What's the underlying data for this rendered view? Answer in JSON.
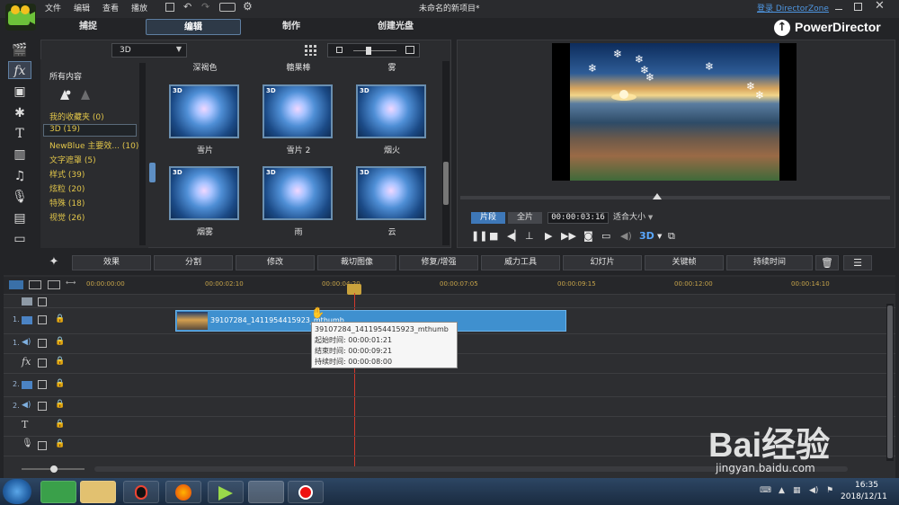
{
  "menu": {
    "file": "文件",
    "edit": "编辑",
    "view": "查看",
    "play": "播放",
    "project_title": "未命名的新项目*",
    "login": "登录 DirectorZone"
  },
  "brand": {
    "name": "PowerDirector"
  },
  "tabs": {
    "capture": "捕捉",
    "edit": "编辑",
    "produce": "制作",
    "disc": "创建光盘"
  },
  "library": {
    "filter_value": "3D",
    "all_content": "所有内容",
    "top_labels": [
      "深褐色",
      "糖果棒",
      "雾"
    ],
    "categories": [
      {
        "label": "我的收藏夹 (0)"
      },
      {
        "label": "3D (19)"
      },
      {
        "label": "NewBlue 主要效... (10)"
      },
      {
        "label": "文字遮罩 (5)"
      },
      {
        "label": "样式 (39)"
      },
      {
        "label": "炫粒 (20)"
      },
      {
        "label": "特殊 (18)"
      },
      {
        "label": "视觉 (26)"
      }
    ],
    "effects": [
      "雪片",
      "雪片 2",
      "烟火",
      "烟雾",
      "雨",
      "云"
    ],
    "thumb_badge": "3D"
  },
  "preview": {
    "clip_tab": "片段",
    "full_tab": "全片",
    "timecode": "00:00:03:16",
    "fit": "适合大小",
    "btn_3d": "3D"
  },
  "edit_buttons": [
    "效果",
    "分割",
    "修改",
    "裁切图像",
    "修复/增强",
    "威力工具",
    "幻灯片",
    "关键帧",
    "持续时间"
  ],
  "timeline": {
    "ruler": [
      "00:00:00:00",
      "00:00:02:10",
      "00:00:04:20",
      "00:00:07:05",
      "00:00:09:15",
      "00:00:12:00",
      "00:00:14:10"
    ],
    "track_labels": [
      "1.",
      "1.",
      "2.",
      "2."
    ],
    "clip_name": "39107284_1411954415923_mthumb",
    "clip_tail": "mthumb",
    "tooltip": {
      "title": "39107284_1411954415923_mthumb",
      "start": "起始时间: 00:00:01:21",
      "end": "结束时间: 00:00:09:21",
      "duration": "持续时间:  00:00:08:00"
    }
  },
  "taskbar": {
    "time": "16:35",
    "date": "2018/12/11"
  },
  "watermark": {
    "text": "Bai经验",
    "sub": "jingyan.baidu.com"
  }
}
